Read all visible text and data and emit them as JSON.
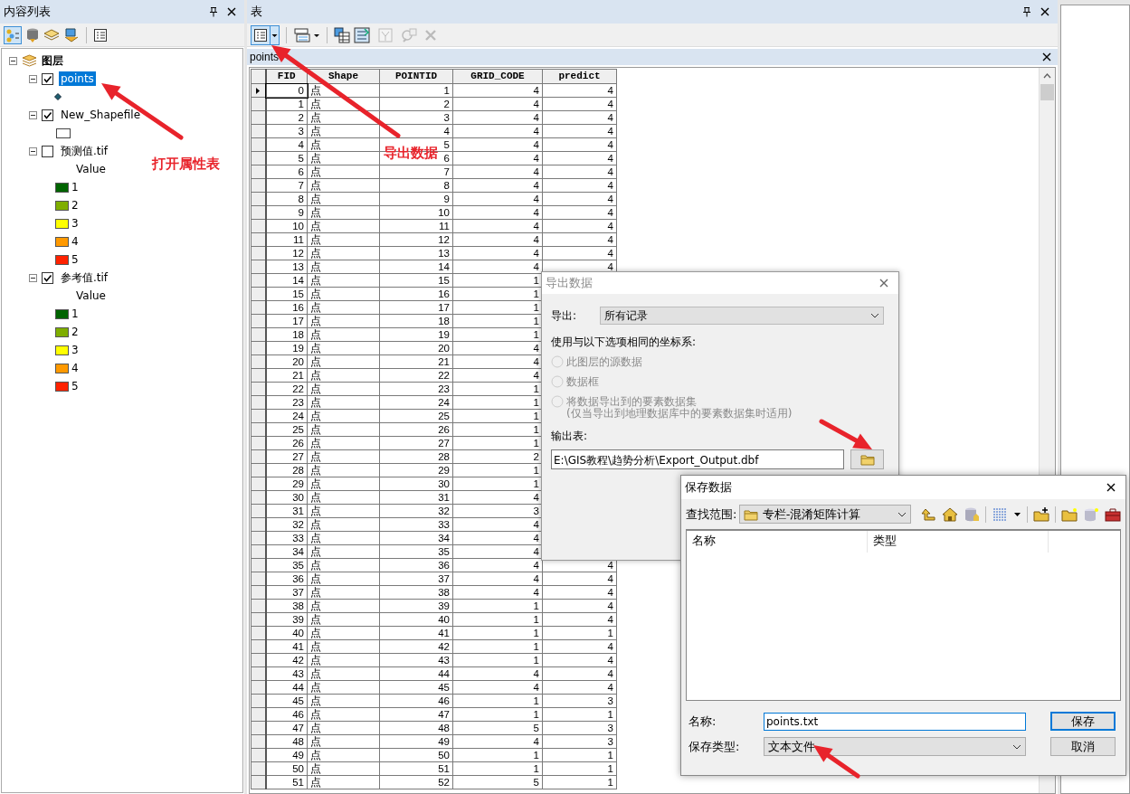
{
  "toc": {
    "title": "内容列表",
    "tree": [
      {
        "label": "图层",
        "expanded": true,
        "children": [
          {
            "label": "points",
            "kind": "point",
            "checked": true,
            "selected": true,
            "expanded": true
          },
          {
            "label": "New_Shapefile",
            "kind": "polygon",
            "checked": true,
            "selected": false,
            "expanded": true
          },
          {
            "label": "预测值.tif",
            "kind": "raster",
            "checked": false,
            "selected": false,
            "expanded": true,
            "field": "Value",
            "legend": [
              {
                "label": "1",
                "color": "#006400"
              },
              {
                "label": "2",
                "color": "#7fae00"
              },
              {
                "label": "3",
                "color": "#ffff00"
              },
              {
                "label": "4",
                "color": "#ff9900"
              },
              {
                "label": "5",
                "color": "#ff2200"
              }
            ]
          },
          {
            "label": "参考值.tif",
            "kind": "raster",
            "checked": true,
            "selected": false,
            "expanded": true,
            "field": "Value",
            "legend": [
              {
                "label": "1",
                "color": "#006400"
              },
              {
                "label": "2",
                "color": "#7fae00"
              },
              {
                "label": "3",
                "color": "#ffff00"
              },
              {
                "label": "4",
                "color": "#ff9900"
              },
              {
                "label": "5",
                "color": "#ff2200"
              }
            ]
          }
        ]
      }
    ]
  },
  "table_window": {
    "title": "表",
    "tab": "points",
    "columns": [
      "FID",
      "Shape",
      "POINTID",
      "GRID_CODE",
      "predict"
    ],
    "rows": [
      {
        "cells": [
          "0",
          "点",
          "1",
          "4",
          "4"
        ],
        "current": true
      },
      {
        "cells": [
          "1",
          "点",
          "2",
          "4",
          "4"
        ],
        "current": false
      },
      {
        "cells": [
          "2",
          "点",
          "3",
          "4",
          "4"
        ],
        "current": false
      },
      {
        "cells": [
          "3",
          "点",
          "4",
          "4",
          "4"
        ],
        "current": false
      },
      {
        "cells": [
          "4",
          "点",
          "5",
          "4",
          "4"
        ],
        "current": false
      },
      {
        "cells": [
          "5",
          "点",
          "6",
          "4",
          "4"
        ],
        "current": false
      },
      {
        "cells": [
          "6",
          "点",
          "7",
          "4",
          "4"
        ],
        "current": false
      },
      {
        "cells": [
          "7",
          "点",
          "8",
          "4",
          "4"
        ],
        "current": false
      },
      {
        "cells": [
          "8",
          "点",
          "9",
          "4",
          "4"
        ],
        "current": false
      },
      {
        "cells": [
          "9",
          "点",
          "10",
          "4",
          "4"
        ],
        "current": false
      },
      {
        "cells": [
          "10",
          "点",
          "11",
          "4",
          "4"
        ],
        "current": false
      },
      {
        "cells": [
          "11",
          "点",
          "12",
          "4",
          "4"
        ],
        "current": false
      },
      {
        "cells": [
          "12",
          "点",
          "13",
          "4",
          "4"
        ],
        "current": false
      },
      {
        "cells": [
          "13",
          "点",
          "14",
          "4",
          "4"
        ],
        "current": false
      },
      {
        "cells": [
          "14",
          "点",
          "15",
          "1"
        ],
        "current": false
      },
      {
        "cells": [
          "15",
          "点",
          "16",
          "1"
        ],
        "current": false
      },
      {
        "cells": [
          "16",
          "点",
          "17",
          "1"
        ],
        "current": false
      },
      {
        "cells": [
          "17",
          "点",
          "18",
          "1"
        ],
        "current": false
      },
      {
        "cells": [
          "18",
          "点",
          "19",
          "1"
        ],
        "current": false
      },
      {
        "cells": [
          "19",
          "点",
          "20",
          "4"
        ],
        "current": false
      },
      {
        "cells": [
          "20",
          "点",
          "21",
          "4"
        ],
        "current": false
      },
      {
        "cells": [
          "21",
          "点",
          "22",
          "4"
        ],
        "current": false
      },
      {
        "cells": [
          "22",
          "点",
          "23",
          "1"
        ],
        "current": false
      },
      {
        "cells": [
          "23",
          "点",
          "24",
          "1"
        ],
        "current": false
      },
      {
        "cells": [
          "24",
          "点",
          "25",
          "1"
        ],
        "current": false
      },
      {
        "cells": [
          "25",
          "点",
          "26",
          "1"
        ],
        "current": false
      },
      {
        "cells": [
          "26",
          "点",
          "27",
          "1"
        ],
        "current": false
      },
      {
        "cells": [
          "27",
          "点",
          "28",
          "2"
        ],
        "current": false
      },
      {
        "cells": [
          "28",
          "点",
          "29",
          "1"
        ],
        "current": false
      },
      {
        "cells": [
          "29",
          "点",
          "30",
          "1"
        ],
        "current": false
      },
      {
        "cells": [
          "30",
          "点",
          "31",
          "4"
        ],
        "current": false
      },
      {
        "cells": [
          "31",
          "点",
          "32",
          "3"
        ],
        "current": false
      },
      {
        "cells": [
          "32",
          "点",
          "33",
          "4"
        ],
        "current": false
      },
      {
        "cells": [
          "33",
          "点",
          "34",
          "4"
        ],
        "current": false
      },
      {
        "cells": [
          "34",
          "点",
          "35",
          "4"
        ],
        "current": false
      },
      {
        "cells": [
          "35",
          "点",
          "36",
          "4",
          "4"
        ],
        "current": false
      },
      {
        "cells": [
          "36",
          "点",
          "37",
          "4",
          "4"
        ],
        "current": false
      },
      {
        "cells": [
          "37",
          "点",
          "38",
          "4",
          "4"
        ],
        "current": false
      },
      {
        "cells": [
          "38",
          "点",
          "39",
          "1",
          "4"
        ],
        "current": false
      },
      {
        "cells": [
          "39",
          "点",
          "40",
          "1",
          "4"
        ],
        "current": false
      },
      {
        "cells": [
          "40",
          "点",
          "41",
          "1",
          "1"
        ],
        "current": false
      },
      {
        "cells": [
          "41",
          "点",
          "42",
          "1",
          "4"
        ],
        "current": false
      },
      {
        "cells": [
          "42",
          "点",
          "43",
          "1",
          "4"
        ],
        "current": false
      },
      {
        "cells": [
          "43",
          "点",
          "44",
          "4",
          "4"
        ],
        "current": false
      },
      {
        "cells": [
          "44",
          "点",
          "45",
          "4",
          "4"
        ],
        "current": false
      },
      {
        "cells": [
          "45",
          "点",
          "46",
          "1",
          "3"
        ],
        "current": false
      },
      {
        "cells": [
          "46",
          "点",
          "47",
          "1",
          "1"
        ],
        "current": false
      },
      {
        "cells": [
          "47",
          "点",
          "48",
          "5",
          "3"
        ],
        "current": false
      },
      {
        "cells": [
          "48",
          "点",
          "49",
          "4",
          "3"
        ],
        "current": false
      },
      {
        "cells": [
          "49",
          "点",
          "50",
          "1",
          "1"
        ],
        "current": false
      },
      {
        "cells": [
          "50",
          "点",
          "51",
          "1",
          "1"
        ],
        "current": false
      },
      {
        "cells": [
          "51",
          "点",
          "52",
          "5",
          "1"
        ],
        "current": false
      }
    ]
  },
  "export_dialog": {
    "title": "导出数据",
    "active": false,
    "export_label": "导出:",
    "export_value": "所有记录",
    "coord_label": "使用与以下选项相同的坐标系:",
    "options": [
      {
        "label": "此图层的源数据",
        "selected": false,
        "disabled": true
      },
      {
        "label": "数据框",
        "selected": false,
        "disabled": true
      },
      {
        "label": "将数据导出到的要素数据集",
        "note": "(仅当导出到地理数据库中的要素数据集时适用)",
        "selected": false,
        "disabled": true
      }
    ],
    "output_label": "输出表:",
    "output_value": "E:\\GIS教程\\趋势分析\\Export_Output.dbf"
  },
  "save_dialog": {
    "title": "保存数据",
    "look_in_label": "查找范围:",
    "look_in_value": "专栏-混淆矩阵计算",
    "columns": [
      "名称",
      "类型"
    ],
    "name_label": "名称:",
    "name_value": "points.txt",
    "type_label": "保存类型:",
    "type_value": "文本文件",
    "buttons": [
      {
        "label": "保存",
        "default": true
      },
      {
        "label": "取消",
        "default": false
      }
    ]
  },
  "annotations": [
    {
      "text": "打开属性表"
    },
    {
      "text": "导出数据"
    }
  ]
}
